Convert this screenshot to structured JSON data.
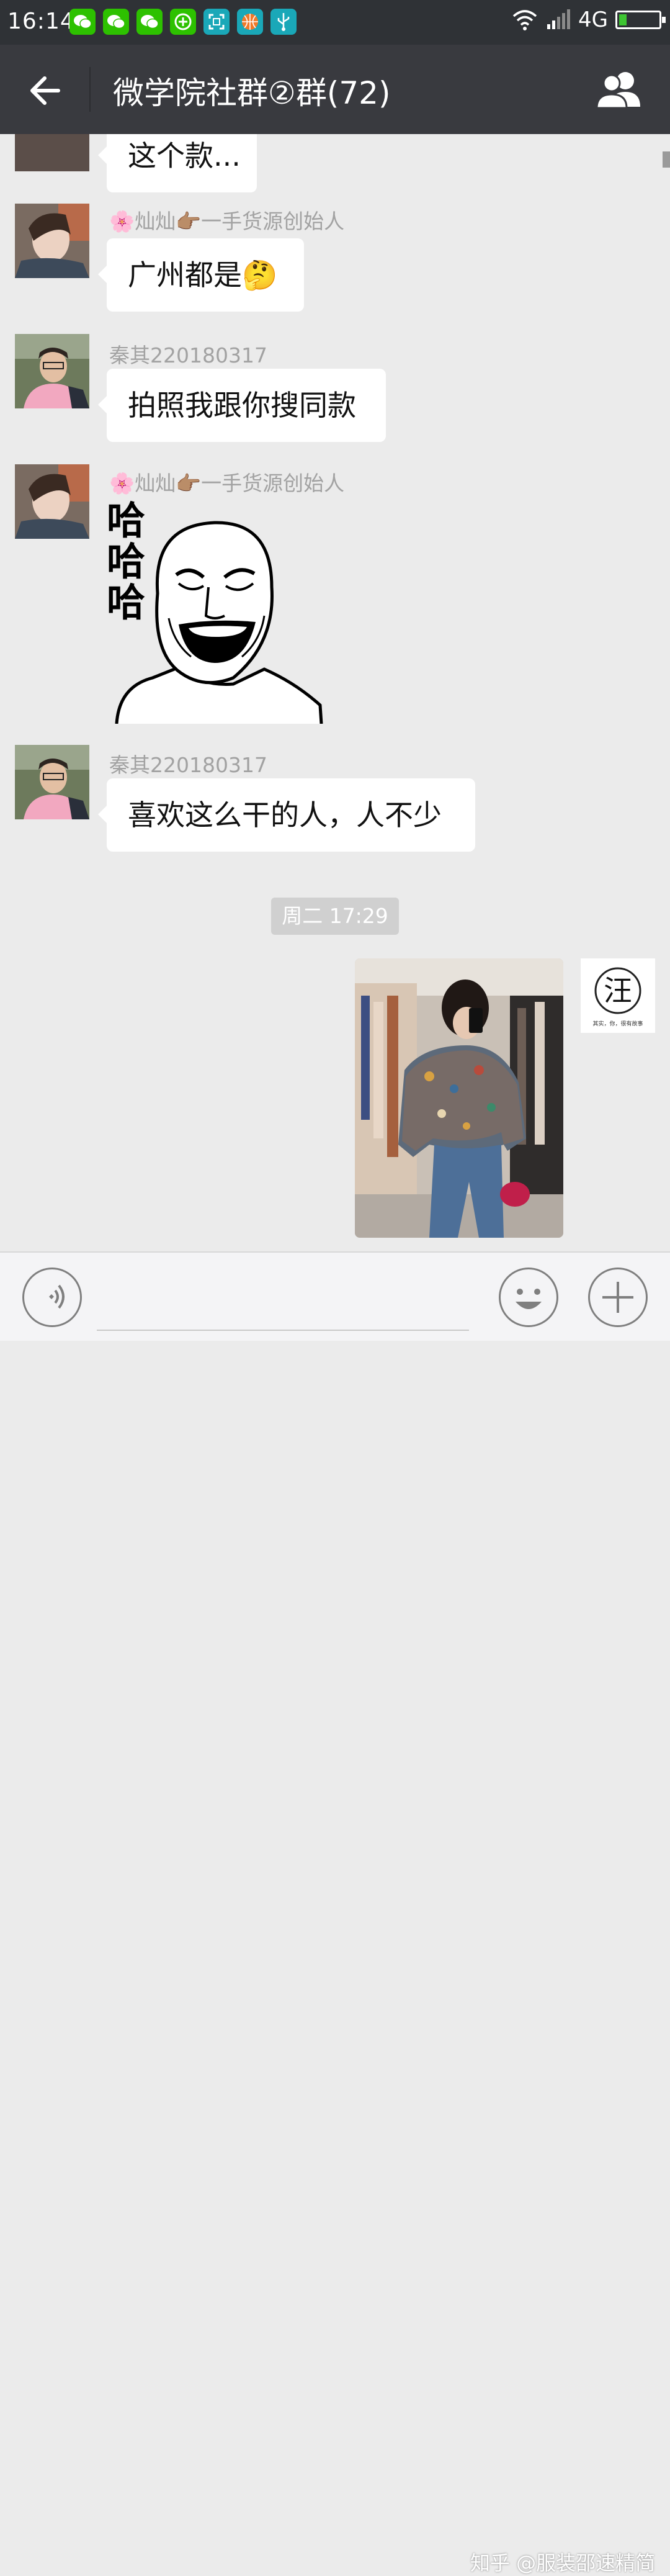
{
  "status_bar": {
    "time": "16:14",
    "network": "4G",
    "app_icons": [
      "wechat-icon",
      "wechat-icon",
      "wechat-icon",
      "plus-app-icon",
      "scan-app-icon",
      "basketball-app-icon",
      "usb-icon"
    ],
    "battery_level": 0.2
  },
  "header": {
    "title": "微学院社群②群(72)",
    "back_icon": "arrow-left-icon",
    "members_icon": "group-members-icon"
  },
  "messages": [
    {
      "text": "这个款..."
    },
    {
      "sender": "🌸灿灿👉🏽一手货源创始人",
      "text": "广州都是🤔"
    },
    {
      "sender": "秦其220180317",
      "text": "拍照我跟你搜同款"
    },
    {
      "sender": "🌸灿灿👉🏽一手货源创始人",
      "sticker": "哈哈哈"
    },
    {
      "sender": "秦其220180317",
      "text": "喜欢这么干的人，人不少"
    }
  ],
  "timestamp": "周二 17:29",
  "my_message": {
    "avatar_char": "汪",
    "avatar_caption": "其实，你，很有故事",
    "image": "photo of a person in a floral blouse and jeans taking a mirror selfie in a clothing store"
  },
  "input_bar": {
    "voice_icon": "voice-icon",
    "emoji_icon": "emoji-icon",
    "plus_icon": "plus-icon"
  },
  "watermark": "知乎 @服装邵速精简",
  "colors": {
    "header_bg": "#393a3f",
    "chat_bg": "#ebebeb",
    "bubble_bg": "#ffffff"
  }
}
